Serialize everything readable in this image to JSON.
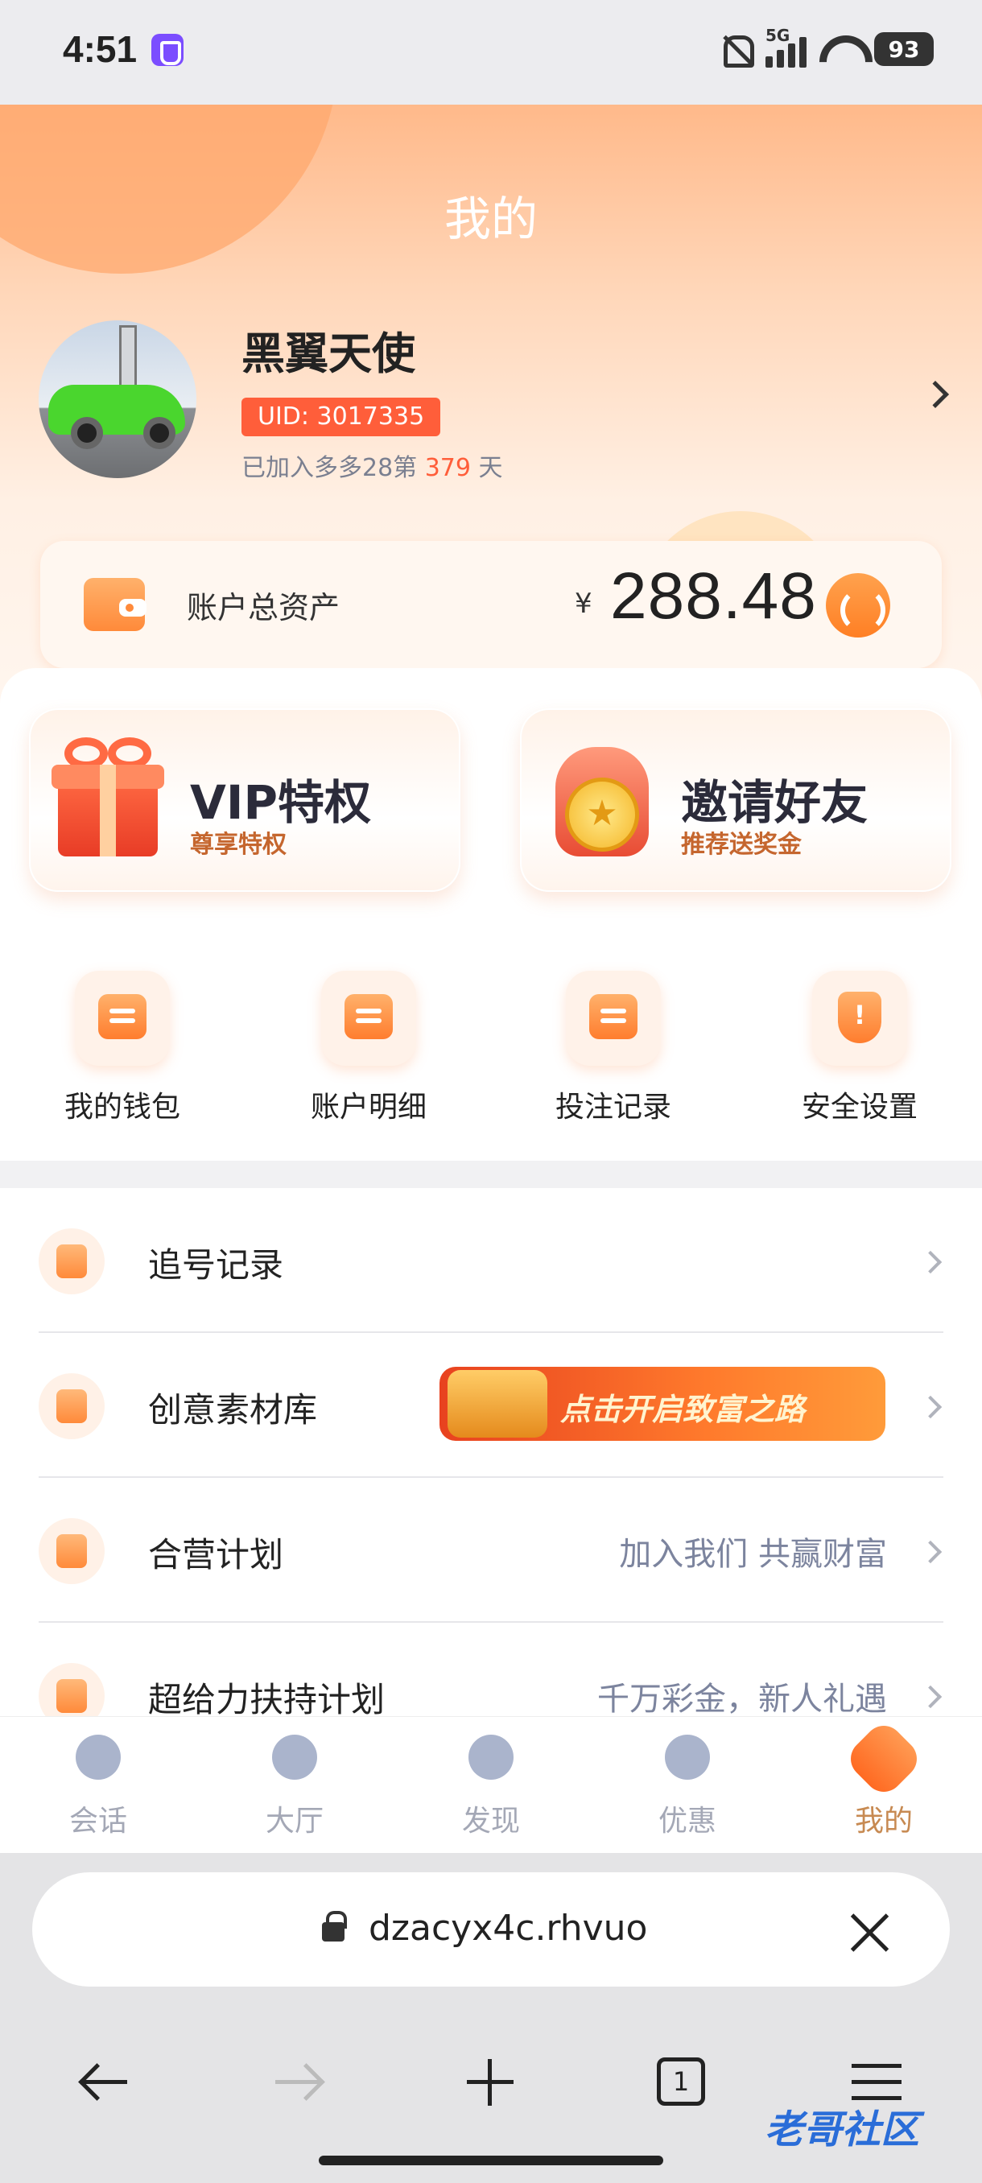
{
  "status_bar": {
    "time": "4:51",
    "network": "5G",
    "battery": "93"
  },
  "header": {
    "title": "我的"
  },
  "profile": {
    "name": "黑翼天使",
    "uid": "UID: 3017335",
    "join_prefix": "已加入多多28第 ",
    "join_days": "379",
    "join_suffix": " 天"
  },
  "assets": {
    "label": "账户总资产",
    "currency": "¥",
    "amount": "288.48"
  },
  "promos": [
    {
      "title": "VIP特权",
      "subtitle": "尊享特权"
    },
    {
      "title": "邀请好友",
      "subtitle": "推荐送奖金"
    }
  ],
  "quick_actions": [
    {
      "label": "我的钱包",
      "icon": "wallet-icon"
    },
    {
      "label": "账户明细",
      "icon": "statement-icon"
    },
    {
      "label": "投注记录",
      "icon": "bet-record-icon"
    },
    {
      "label": "安全设置",
      "icon": "shield-icon"
    }
  ],
  "menu": [
    {
      "label": "追号记录",
      "detail": ""
    },
    {
      "label": "创意素材库",
      "banner": "点击开启致富之路"
    },
    {
      "label": "合营计划",
      "detail": "加入我们 共赢财富"
    },
    {
      "label": "超给力扶持计划",
      "detail": "千万彩金，新人礼遇"
    }
  ],
  "tabs": [
    {
      "label": "会话"
    },
    {
      "label": "大厅"
    },
    {
      "label": "发现"
    },
    {
      "label": "优惠"
    },
    {
      "label": "我的"
    }
  ],
  "browser": {
    "url": "dzacyx4c.rhvuo",
    "tab_count": "1"
  },
  "watermark": "老哥社区"
}
